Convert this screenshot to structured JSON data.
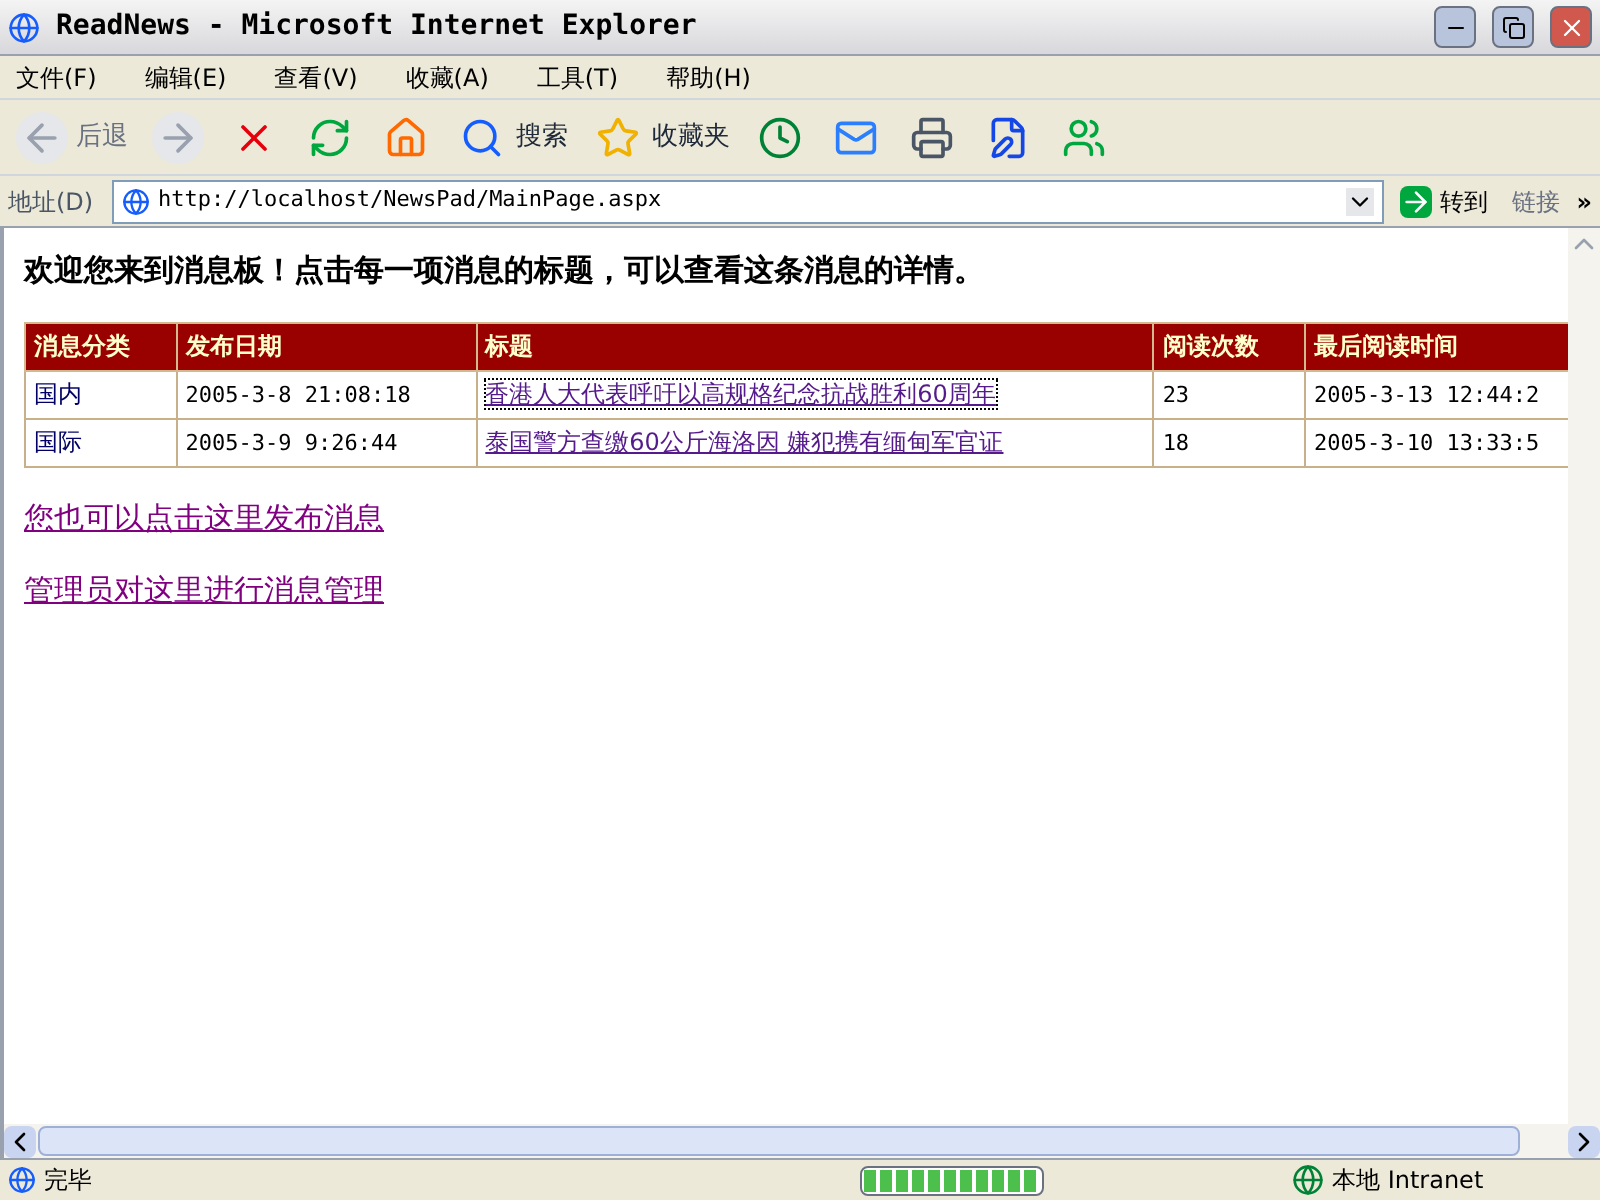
{
  "window": {
    "title": "ReadNews - Microsoft Internet Explorer"
  },
  "menu": [
    "文件(F)",
    "编辑(E)",
    "查看(V)",
    "收藏(A)",
    "工具(T)",
    "帮助(H)"
  ],
  "toolbar": [
    {
      "kind": "back",
      "label": "后退"
    },
    {
      "kind": "forward"
    },
    {
      "kind": "stop"
    },
    {
      "kind": "refresh"
    },
    {
      "kind": "home"
    },
    {
      "kind": "search",
      "label": "搜索"
    },
    {
      "kind": "favorites",
      "label": "收藏夹"
    },
    {
      "kind": "history"
    },
    {
      "kind": "mail"
    },
    {
      "kind": "print"
    },
    {
      "kind": "edit"
    },
    {
      "kind": "messenger"
    }
  ],
  "address": {
    "label": "地址(D)",
    "value": "http://localhost/NewsPad/MainPage.aspx",
    "go": "转到",
    "links": "链接",
    "more": "»"
  },
  "page": {
    "heading": "欢迎您来到消息板！点击每一项消息的标题，可以查看这条消息的详情。",
    "table": {
      "columns": [
        "消息分类",
        "发布日期",
        "标题",
        "阅读次数",
        "最后阅读时间"
      ],
      "rows": [
        {
          "focused": true,
          "cells": [
            "国内",
            "2005-3-8 21:08:18",
            "香港人大代表呼吁以高规格纪念抗战胜利60周年",
            "23",
            "2005-3-13 12:44:2"
          ]
        },
        {
          "focused": false,
          "cells": [
            "国际",
            "2005-3-9 9:26:44",
            "泰国警方查缴60公斤海洛因 嫌犯携有缅甸军官证",
            "18",
            "2005-3-10 13:33:5"
          ]
        }
      ]
    },
    "links": [
      "您也可以点击这里发布消息",
      "管理员对这里进行消息管理"
    ]
  },
  "status_bar": {
    "text": "完毕",
    "progress": {
      "level": 1
    },
    "zone": "本地 Intranet"
  }
}
